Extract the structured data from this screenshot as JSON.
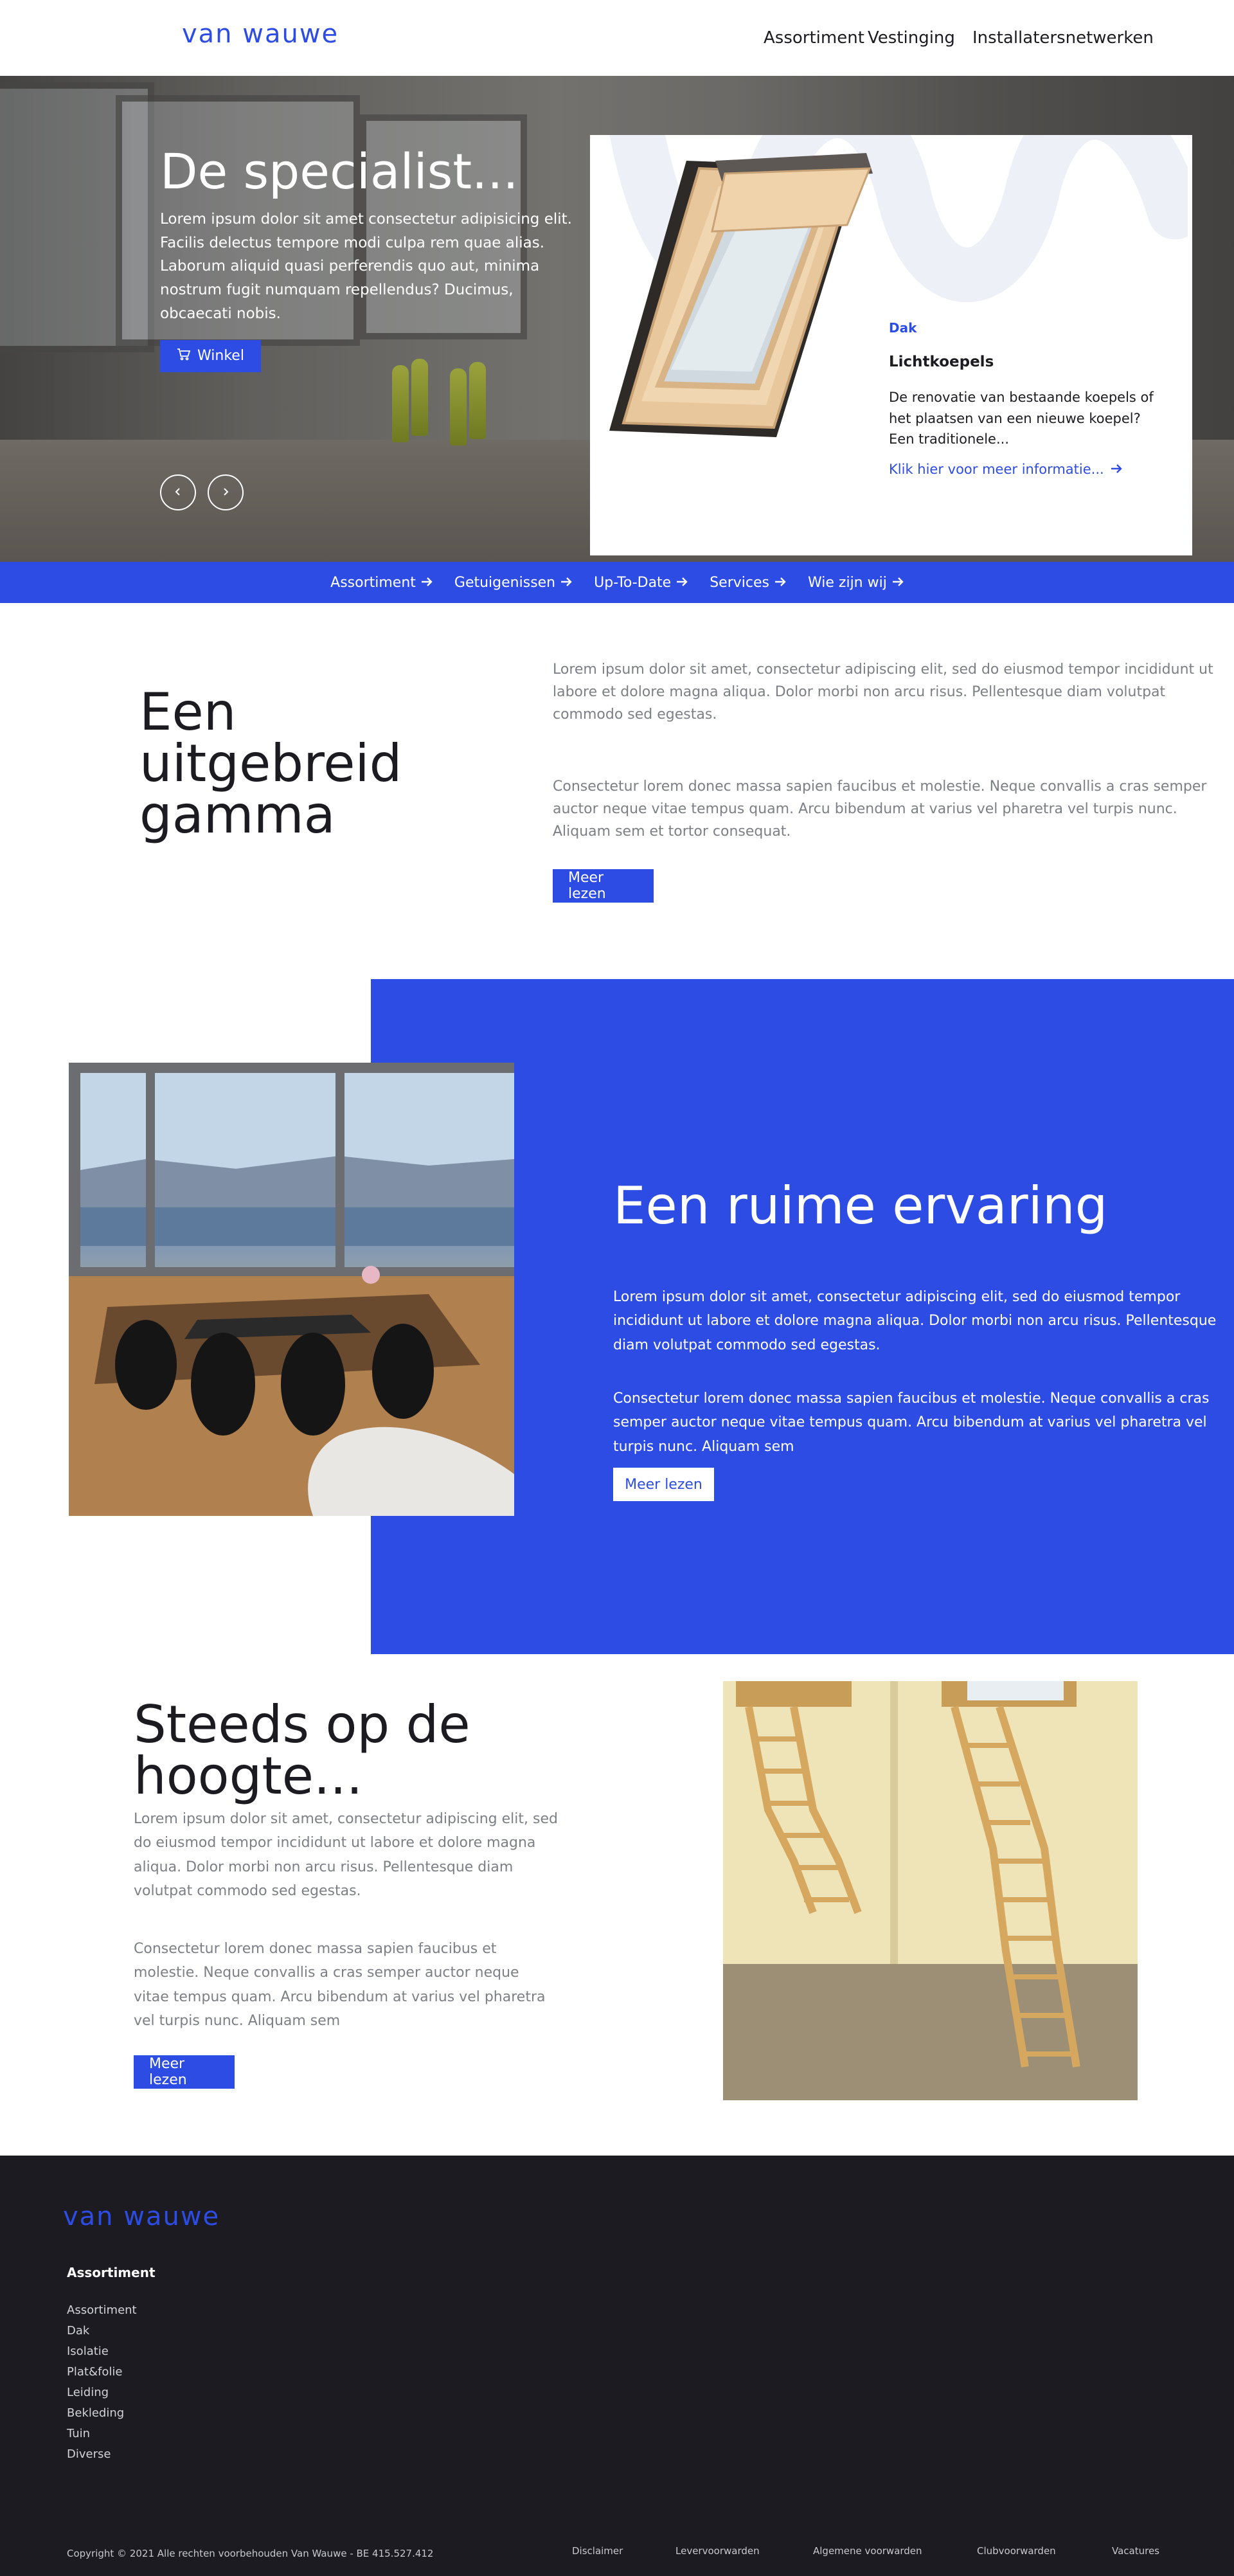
{
  "brand": {
    "logo": "van wauwe",
    "accent_color": "#2d4ce4",
    "dark_color": "#1c1b22"
  },
  "topnav": [
    "Assortiment",
    "Vestinging",
    "Installatersnetwerken"
  ],
  "hero": {
    "title": "De specialist...",
    "body": "Lorem ipsum dolor sit amet consectetur adipisicing elit. Facilis delectus tempore modi culpa rem quae alias. Laborum aliquid quasi perferendis quo aut, minima nostrum fugit numquam repellendus? Ducimus, obcaecati nobis.",
    "shop_label": "Winkel",
    "shop_icon": "cart-icon",
    "prev_icon": "chevron-left-icon",
    "next_icon": "chevron-right-icon",
    "card": {
      "category": "Dak",
      "title": "Lichtkoepels",
      "text_line1": "De renovatie van bestaande koepels of het plaatsen van een nieuwe koepel?",
      "text_line2": "Een traditionele...",
      "link": "Klik hier voor meer informatie..."
    }
  },
  "subnav": [
    "Assortiment",
    "Getuigenissen",
    "Up-To-Date",
    "Services",
    "Wie zijn wij"
  ],
  "section_gamma": {
    "title": "Een uitgebreid gamma",
    "p1": "Lorem ipsum dolor sit amet, consectetur adipiscing elit, sed do eiusmod tempor incididunt ut labore et dolore magna aliqua. Dolor morbi non arcu risus. Pellentesque diam volutpat commodo sed egestas.",
    "p2": "Consectetur lorem donec massa sapien faucibus et molestie. Neque convallis a cras semper auctor neque vitae tempus quam. Arcu bibendum at varius vel pharetra vel turpis nunc. Aliquam sem et tortor consequat.",
    "button": "Meer lezen"
  },
  "section_ervaring": {
    "title": "Een ruime ervaring",
    "p1": "Lorem ipsum dolor sit amet, consectetur adipiscing elit, sed do eiusmod tempor incididunt ut labore et dolore magna aliqua. Dolor morbi non arcu risus. Pellentesque diam volutpat commodo sed egestas.",
    "p2": "Consectetur lorem donec massa sapien faucibus et molestie. Neque convallis a cras semper auctor neque vitae tempus quam. Arcu bibendum at varius vel pharetra vel turpis nunc. Aliquam sem",
    "button": "Meer lezen"
  },
  "section_hoogte": {
    "title": "Steeds op de hoogte...",
    "p1": "Lorem ipsum dolor sit amet, consectetur adipiscing elit, sed do eiusmod tempor incididunt ut labore et dolore magna aliqua. Dolor morbi non arcu risus. Pellentesque diam volutpat commodo sed egestas.",
    "p2": "Consectetur lorem donec massa sapien faucibus et molestie. Neque convallis a cras semper auctor neque vitae tempus quam. Arcu bibendum at varius vel pharetra vel turpis nunc. Aliquam sem",
    "button": "Meer lezen"
  },
  "footer": {
    "logo": "van wauwe",
    "heading": "Assortiment",
    "links": [
      "Assortiment",
      "Dak",
      "Isolatie",
      "Plat&folie",
      "Leiding",
      "Bekleding",
      "Tuin",
      "Diverse"
    ],
    "copyright": "Copyright © 2021 Alle rechten voorbehouden Van Wauwe - BE 415.527.412",
    "legal": [
      "Disclaimer",
      "Levervoorwarden",
      "Algemene voorwarden",
      "Clubvoorwarden",
      "Vacatures"
    ]
  }
}
